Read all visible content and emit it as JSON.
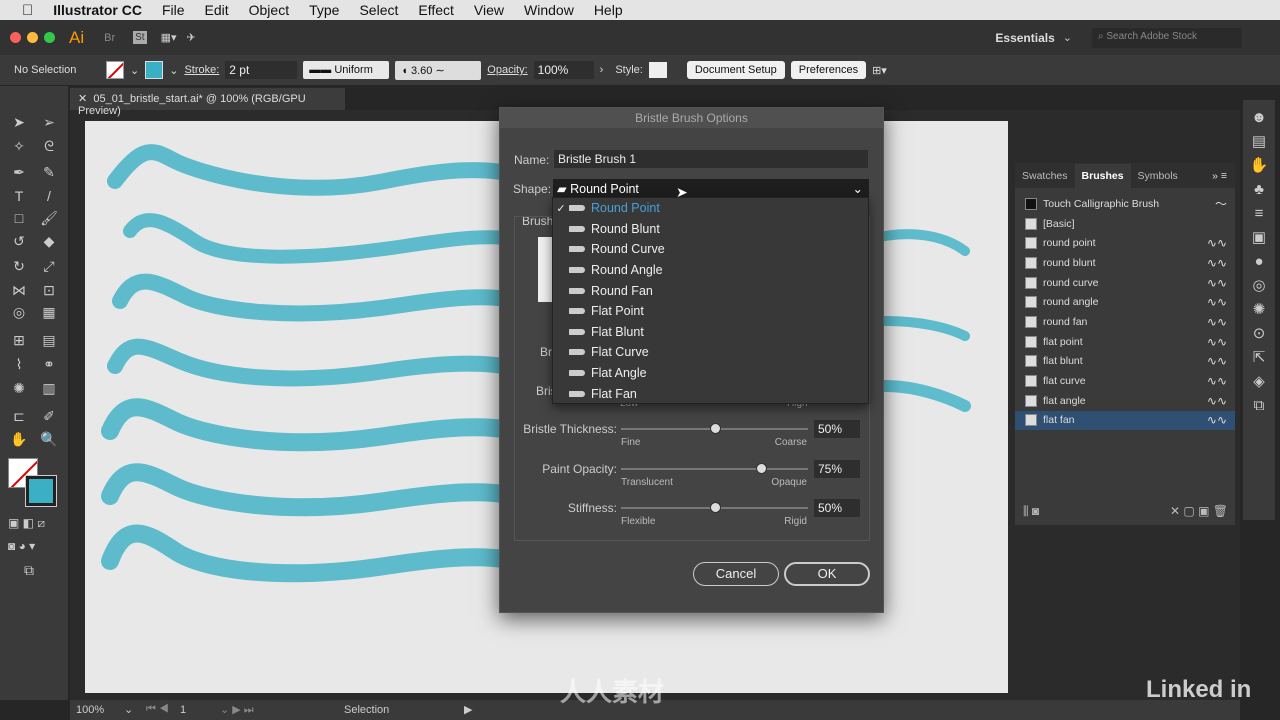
{
  "menubar": {
    "apple": "",
    "app": "Illustrator CC",
    "items": [
      "File",
      "Edit",
      "Object",
      "Type",
      "Select",
      "Effect",
      "View",
      "Window",
      "Help"
    ]
  },
  "appbar": {
    "logo": "Ai",
    "br": "Br",
    "st": "St",
    "workspace": "Essentials",
    "search_placeholder": "Search Adobe Stock"
  },
  "control": {
    "selection": "No Selection",
    "stroke_label": "Stroke:",
    "stroke_value": "2 pt",
    "profile": "Uniform",
    "brush_size": "3.60",
    "opacity_label": "Opacity:",
    "opacity_value": "100%",
    "style_label": "Style:",
    "doc_setup": "Document Setup",
    "preferences": "Preferences"
  },
  "tab": {
    "title": "05_01_bristle_start.ai* @ 100% (RGB/GPU Preview)"
  },
  "dialog": {
    "title": "Bristle Brush Options",
    "name_label": "Name:",
    "name_value": "Bristle Brush 1",
    "shape_label": "Shape:",
    "shape_value": "Round Point",
    "brush_label": "Brush",
    "bri1": "Bri",
    "bri2": "Bris",
    "low": "Low",
    "high": "High",
    "shape_options": [
      "Round Point",
      "Round Blunt",
      "Round Curve",
      "Round Angle",
      "Round Fan",
      "Flat Point",
      "Flat Blunt",
      "Flat Curve",
      "Flat Angle",
      "Flat Fan"
    ],
    "sliders": [
      {
        "label": "Bristle Thickness:",
        "min": "Fine",
        "max": "Coarse",
        "value": "50%",
        "level": 50
      },
      {
        "label": "Paint Opacity:",
        "min": "Translucent",
        "max": "Opaque",
        "value": "75%",
        "level": 75
      },
      {
        "label": "Stiffness:",
        "min": "Flexible",
        "max": "Rigid",
        "value": "50%",
        "level": 50
      }
    ],
    "cancel": "Cancel",
    "ok": "OK"
  },
  "panel": {
    "tabs": [
      "Swatches",
      "Brushes",
      "Symbols"
    ],
    "items": [
      "Touch Calligraphic Brush",
      "[Basic]",
      "round point",
      "round blunt",
      "round curve",
      "round angle",
      "round fan",
      "flat point",
      "flat blunt",
      "flat curve",
      "flat angle",
      "flat fan"
    ],
    "selected": "flat fan"
  },
  "status": {
    "zoom": "100%",
    "page": "1",
    "tool": "Selection"
  },
  "colors": {
    "accent": "#4a9fd8",
    "stroke": "#3bb0c4",
    "selected_row": "#2f4f73"
  },
  "watermark": "人人素材",
  "linkedin": "Linked in"
}
